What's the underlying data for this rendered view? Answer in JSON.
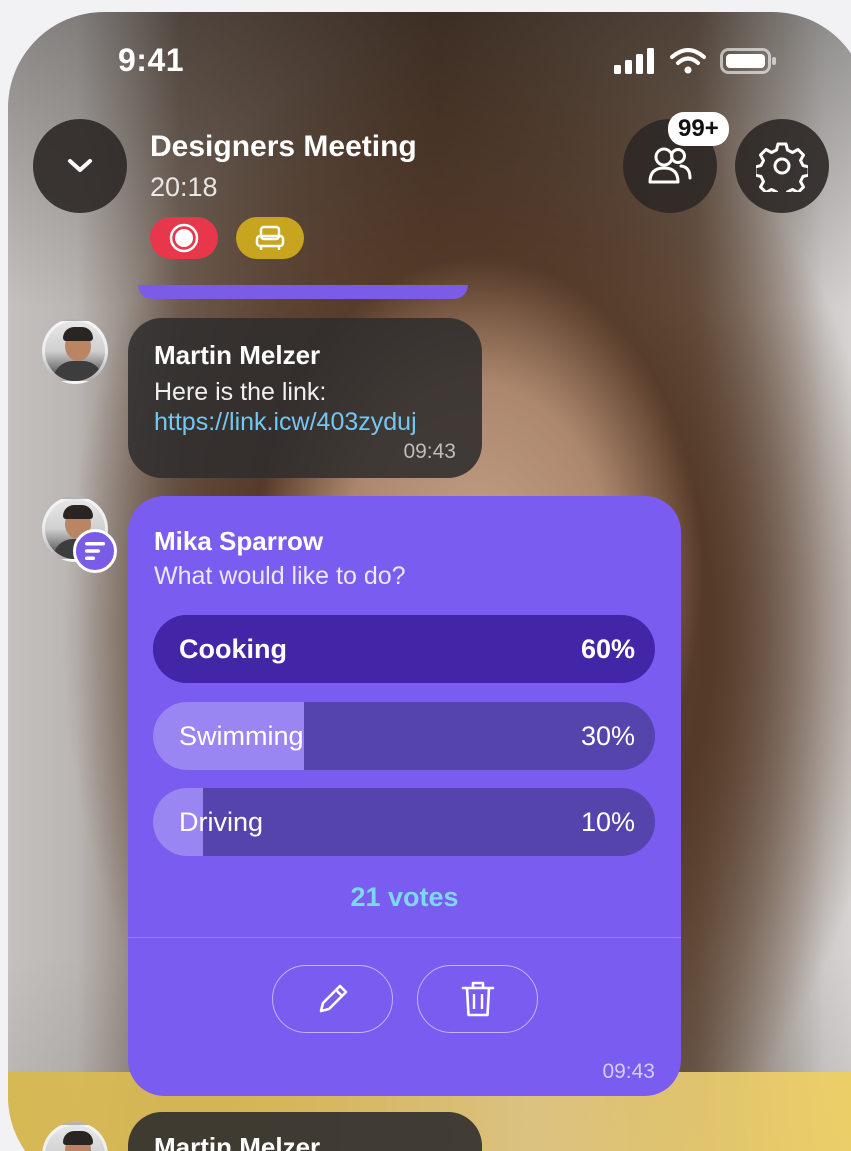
{
  "status_bar": {
    "time": "9:41",
    "icons": [
      "signal-icon",
      "wifi-icon",
      "battery-icon"
    ]
  },
  "header": {
    "title": "Designers Meeting",
    "duration": "20:18",
    "participants_badge": "99+",
    "icons": {
      "back": "chevron-down-icon",
      "participants": "people-icon",
      "settings": "gear-icon"
    }
  },
  "indicators": [
    {
      "name": "recording",
      "icon": "record-icon",
      "color": "#e8374b"
    },
    {
      "name": "seat",
      "icon": "armchair-icon",
      "color": "#c8a51f"
    }
  ],
  "messages": [
    {
      "sender": "Martin Melzer",
      "text": "Here is the link:",
      "link": "https://link.icw/403zyduj",
      "time": "09:43"
    },
    {
      "sender": "Mika Sparrow",
      "question": "What would like to do?",
      "options": [
        {
          "label": "Cooking",
          "percent": "60%",
          "fraction": 0.6,
          "leading": true
        },
        {
          "label": "Swimming",
          "percent": "30%",
          "fraction": 0.3,
          "leading": false
        },
        {
          "label": "Driving",
          "percent": "10%",
          "fraction": 0.1,
          "leading": false
        }
      ],
      "votes": "21 votes",
      "actions": [
        "pencil-icon",
        "trash-icon"
      ],
      "time": "09:43"
    },
    {
      "sender": "Martin Melzer"
    }
  ],
  "colors": {
    "accent": "#7a5cf0",
    "link": "#74c7f0",
    "votes": "#7fd8f3",
    "record": "#e8374b"
  }
}
